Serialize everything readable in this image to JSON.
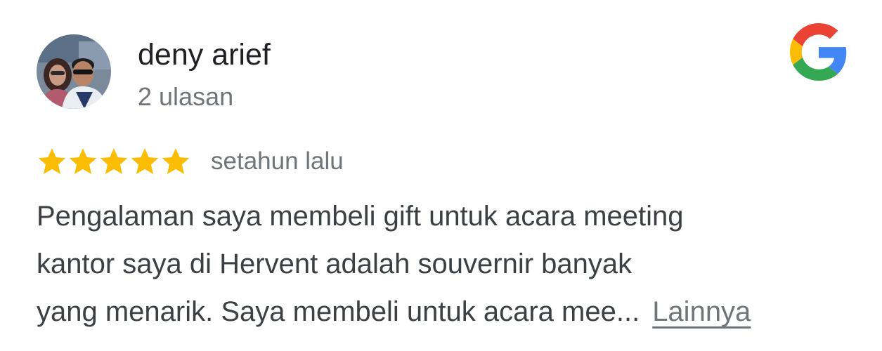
{
  "review": {
    "reviewer_name": "deny arief",
    "review_count": "2 ulasan",
    "rating": 5,
    "rating_max": 5,
    "star_color": "#fbbc04",
    "date": "setahun lalu",
    "text_lines": [
      "Pengalaman saya membeli gift untuk acara meeting",
      "kantor saya di Hervent adalah souvernir banyak",
      "yang menarik. Saya membeli untuk acara mee..."
    ],
    "more_label": "Lainnya"
  },
  "icons": {
    "brand": "google-icon",
    "star": "star-icon",
    "avatar": "reviewer-avatar-photo"
  },
  "colors": {
    "text_primary": "#202124",
    "text_secondary": "#70757a",
    "google_blue": "#4285f4",
    "google_red": "#ea4335",
    "google_yellow": "#fbbc04",
    "google_green": "#34a853"
  }
}
